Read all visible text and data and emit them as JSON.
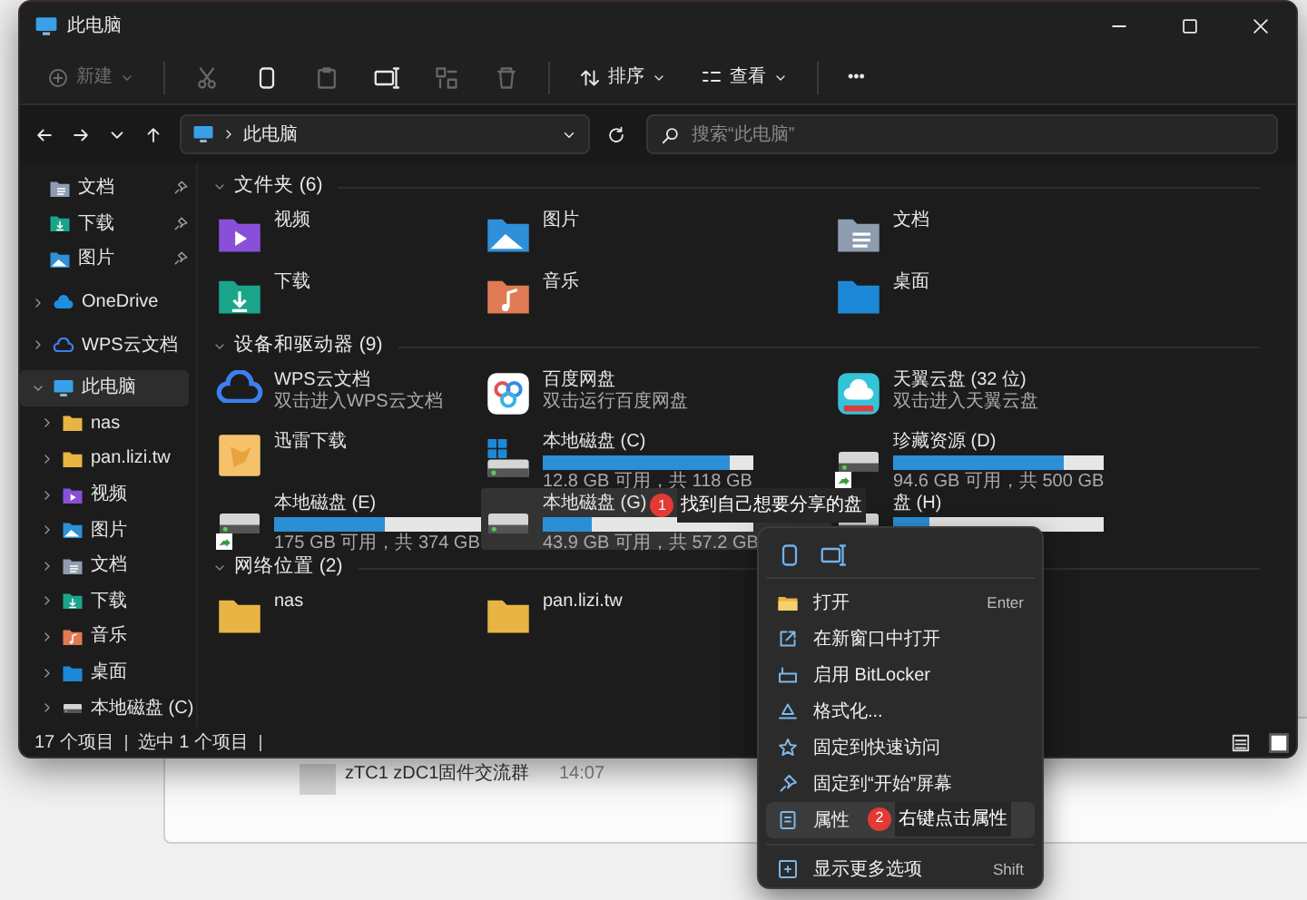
{
  "background": {
    "chat": {
      "title": "zTC1 zDC1固件交流群",
      "time": "14:07"
    }
  },
  "window": {
    "title": "此电脑"
  },
  "toolbar": {
    "new": {
      "label": "新建",
      "disabled": true
    },
    "tools": [
      {
        "kind": "cut",
        "disabled": true
      },
      {
        "kind": "copy",
        "disabled": false
      },
      {
        "kind": "paste",
        "disabled": true
      },
      {
        "kind": "rename",
        "disabled": false
      },
      {
        "kind": "share",
        "disabled": true
      },
      {
        "kind": "delete",
        "disabled": true
      }
    ],
    "sort": "排序",
    "view": "查看",
    "more": "•••"
  },
  "address": {
    "path": "此电脑"
  },
  "search": {
    "placeholder": "搜索“此电脑”"
  },
  "sidebar": {
    "items": [
      {
        "label": "文档",
        "kind": "documents",
        "pinned": true,
        "expanded": false,
        "selected": false
      },
      {
        "label": "下载",
        "kind": "downloads",
        "pinned": true,
        "expanded": false,
        "selected": false
      },
      {
        "label": "图片",
        "kind": "pictures",
        "pinned": true,
        "expanded": false,
        "selected": false
      },
      {
        "label": "OneDrive",
        "kind": "onedrive",
        "pinned": false,
        "expanded": false,
        "selected": false
      },
      {
        "label": "WPS云文档",
        "kind": "wps",
        "pinned": false,
        "expanded": false,
        "selected": false
      },
      {
        "label": "此电脑",
        "kind": "pc",
        "pinned": false,
        "expanded": true,
        "selected": true,
        "children": [
          {
            "label": "nas",
            "kind": "folder",
            "pinned": false,
            "expanded": false,
            "selected": false
          },
          {
            "label": "pan.lizi.tw",
            "kind": "folder",
            "pinned": false,
            "expanded": false,
            "selected": false
          },
          {
            "label": "视频",
            "kind": "videos",
            "pinned": false,
            "expanded": false,
            "selected": false
          },
          {
            "label": "图片",
            "kind": "pictures",
            "pinned": false,
            "expanded": false,
            "selected": false
          },
          {
            "label": "文档",
            "kind": "documents",
            "pinned": false,
            "expanded": false,
            "selected": false
          },
          {
            "label": "下载",
            "kind": "downloads",
            "pinned": false,
            "expanded": false,
            "selected": false
          },
          {
            "label": "音乐",
            "kind": "music",
            "pinned": false,
            "expanded": false,
            "selected": false
          },
          {
            "label": "桌面",
            "kind": "desktop",
            "pinned": false,
            "expanded": false,
            "selected": false
          },
          {
            "label": "本地磁盘 (C)",
            "kind": "drive",
            "pinned": false,
            "expanded": false,
            "selected": false
          }
        ]
      }
    ]
  },
  "sections": [
    {
      "title": "文件夹 (6)",
      "expanded": true,
      "items": [
        {
          "kind": "videos",
          "name": "视频",
          "selected": false
        },
        {
          "kind": "pictures",
          "name": "图片",
          "selected": false
        },
        {
          "kind": "documents",
          "name": "文档",
          "selected": false
        },
        {
          "kind": "downloads",
          "name": "下载",
          "selected": false
        },
        {
          "kind": "music",
          "name": "音乐",
          "selected": false
        },
        {
          "kind": "desktop",
          "name": "桌面",
          "selected": false
        }
      ]
    },
    {
      "title": "设备和驱动器 (9)",
      "expanded": true,
      "items": [
        {
          "kind": "wps",
          "name": "WPS云文档",
          "subtitle": "双击进入WPS云文档",
          "selected": false
        },
        {
          "kind": "baidu",
          "name": "百度网盘",
          "subtitle": "双击运行百度网盘",
          "selected": false
        },
        {
          "kind": "tianyi",
          "name": "天翼云盘 (32 位)",
          "subtitle": "双击进入天翼云盘",
          "selected": false
        },
        {
          "kind": "xunlei",
          "name": "迅雷下载",
          "selected": false
        },
        {
          "kind": "system",
          "name": "本地磁盘 (C)",
          "free": "12.8 GB 可用，共 118 GB",
          "level": 0.89,
          "shared": false,
          "selected": false
        },
        {
          "kind": "disk",
          "name": "珍藏资源 (D)",
          "free": "94.6 GB 可用，共 500 GB",
          "level": 0.81,
          "shared": true,
          "selected": false
        },
        {
          "kind": "disk",
          "name": "本地磁盘 (E)",
          "free": "175 GB 可用，共 374 GB",
          "level": 0.53,
          "shared": true,
          "selected": false
        },
        {
          "kind": "disk",
          "name": "本地磁盘 (G)",
          "free": "43.9 GB 可用，共 57.2 GB",
          "level": 0.23,
          "shared": false,
          "selected": true
        },
        {
          "kind": "disk",
          "name": "盘 (H)",
          "level": 0.17,
          "shared": false,
          "selected": false
        }
      ]
    },
    {
      "title": "网络位置 (2)",
      "expanded": true,
      "items": [
        {
          "kind": "folder",
          "name": "nas",
          "selected": false
        },
        {
          "kind": "folder",
          "name": "pan.lizi.tw",
          "selected": false
        }
      ]
    }
  ],
  "status_bar": {
    "count": "17 个项目",
    "selection": "选中 1 个项目",
    "view_modes": [
      {
        "kind": "details",
        "selected": false
      },
      {
        "kind": "tiles",
        "selected": true
      }
    ]
  },
  "context_menu": {
    "actions": [
      {
        "kind": "copy"
      },
      {
        "kind": "rename"
      }
    ],
    "items": [
      {
        "kind": "open",
        "label": "打开",
        "shortcut": "Enter",
        "selected": false
      },
      {
        "kind": "newwin",
        "label": "在新窗口中打开",
        "selected": false
      },
      {
        "kind": "bitlocker",
        "label": "启用 BitLocker",
        "selected": false
      },
      {
        "kind": "format",
        "label": "格式化...",
        "selected": false
      },
      {
        "kind": "star",
        "label": "固定到快速访问",
        "selected": false
      },
      {
        "kind": "pin",
        "label": "固定到“开始”屏幕",
        "selected": false
      },
      {
        "kind": "props",
        "label": "属性",
        "selected": true
      },
      {
        "kind": "more",
        "label": "显示更多选项",
        "shortcut": "Shift",
        "selected": false
      }
    ]
  },
  "annotations": [
    {
      "number": "1",
      "text": "找到自己想要分享的盘"
    },
    {
      "number": "2",
      "text": "右键点击属性"
    }
  ]
}
